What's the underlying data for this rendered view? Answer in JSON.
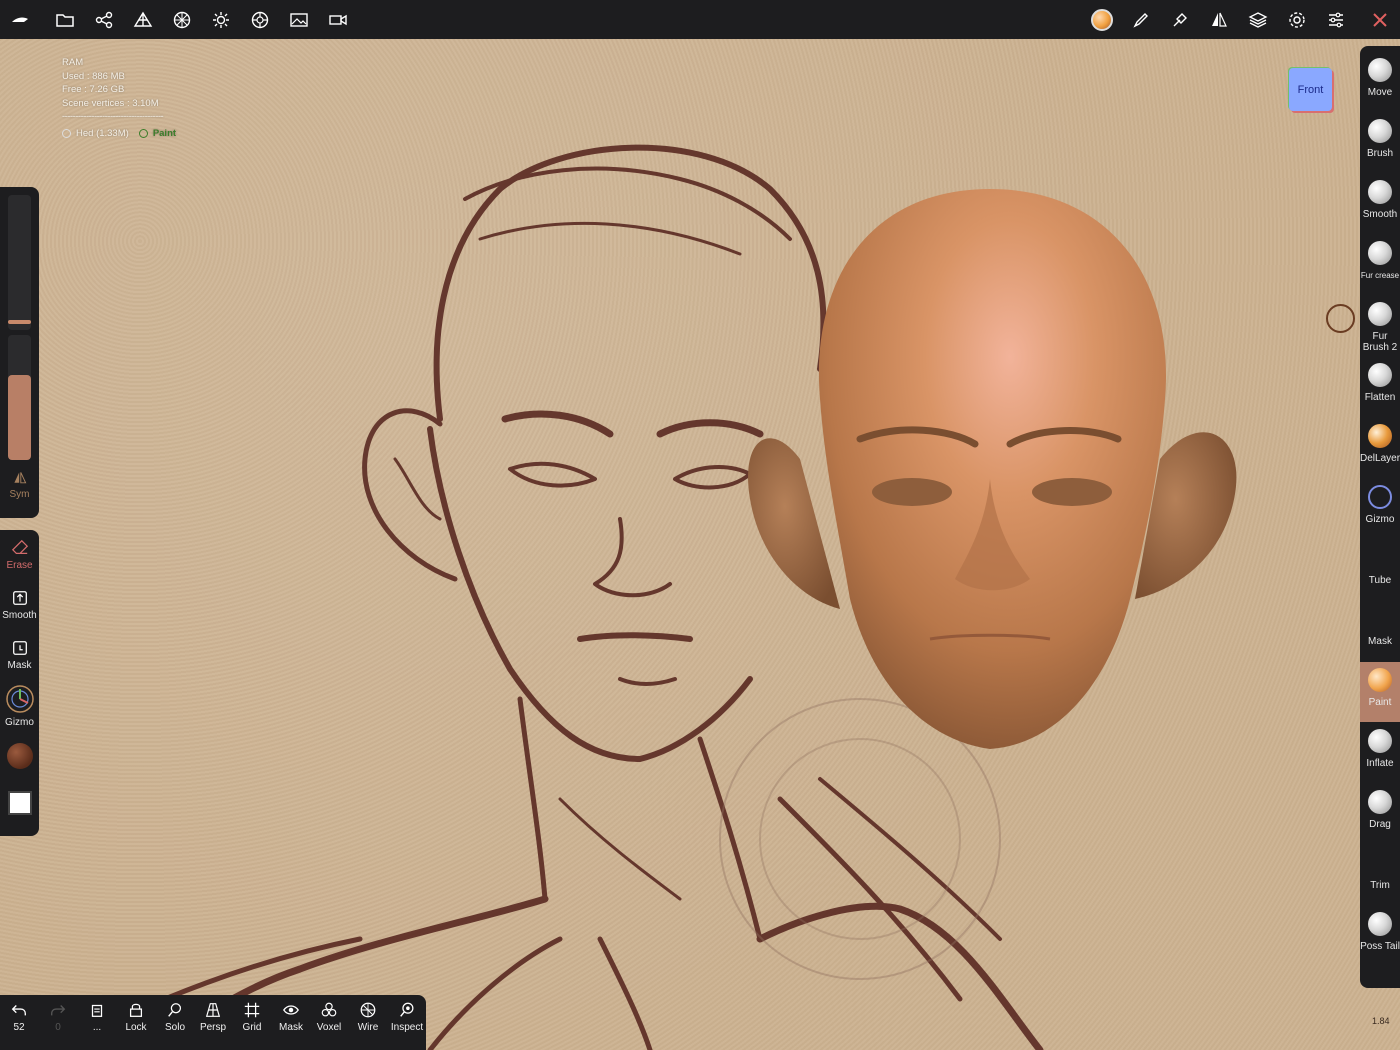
{
  "top_toolbar": {
    "left_icons": [
      "app-logo-icon",
      "folder-icon",
      "scene-graph-icon",
      "topology-icon",
      "sphere-grid-icon",
      "lighting-icon",
      "material-icon",
      "background-image-icon",
      "camera-icon"
    ],
    "right_icons": [
      "active-material-icon",
      "stroke-pen-icon",
      "pick-color-icon",
      "symmetry-icon",
      "layers-icon",
      "settings-icon",
      "sliders-icon",
      "hide-ui-icon"
    ]
  },
  "stats": {
    "title": "RAM",
    "used": "Used : 886 MB",
    "free": "Free : 7.26 GB",
    "vertices": "Scene vertices : 3.10M",
    "separator": "--------------------------------------",
    "mesh_name": "Hed (1.33M)",
    "mode": "Paint"
  },
  "left_slider": {
    "sym_label": "Sym"
  },
  "left_tools": {
    "erase": "Erase",
    "smooth": "Smooth",
    "mask": "Mask",
    "gizmo": "Gizmo"
  },
  "right_tools": [
    {
      "label": "Move"
    },
    {
      "label": "Brush"
    },
    {
      "label": "Smooth"
    },
    {
      "label": "Fur crease"
    },
    {
      "label": "Fur Brush 2"
    },
    {
      "label": "Flatten"
    },
    {
      "label": "DelLayer"
    },
    {
      "label": "Gizmo"
    },
    {
      "label": "Tube"
    },
    {
      "label": "Mask"
    },
    {
      "label": "Paint"
    },
    {
      "label": "Inflate"
    },
    {
      "label": "Drag"
    },
    {
      "label": "Trim"
    },
    {
      "label": "Poss Tail"
    }
  ],
  "gizmo_cube": {
    "face": "Front"
  },
  "bottom_toolbar": {
    "undo_count": "52",
    "redo_count": "0",
    "more": "...",
    "lock": "Lock",
    "solo": "Solo",
    "persp": "Persp",
    "grid": "Grid",
    "mask": "Mask",
    "voxel": "Voxel",
    "wire": "Wire",
    "inspect": "Inspect"
  },
  "footer_value": "1.84",
  "colors": {
    "bar": "#1d1d1f",
    "paint_accent": "#b3806a",
    "canvas": "#ccb291",
    "skin": "#c98656"
  }
}
